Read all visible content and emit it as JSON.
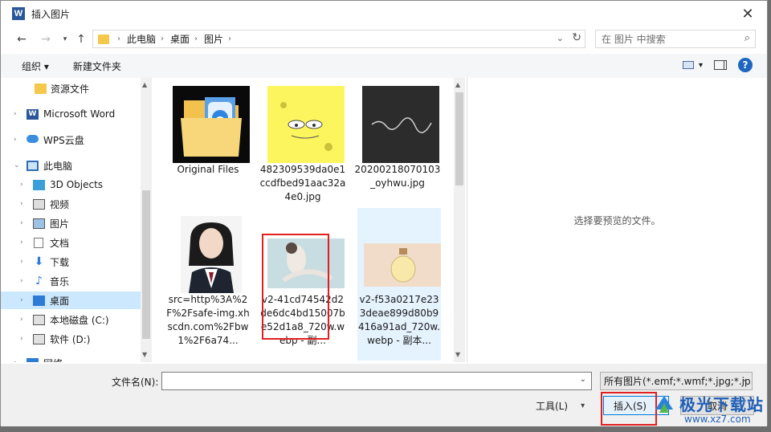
{
  "window": {
    "title": "插入图片",
    "app_icon": "W"
  },
  "nav": {
    "path": [
      "此电脑",
      "桌面",
      "图片"
    ],
    "search_placeholder": "在 图片 中搜索"
  },
  "toolbar": {
    "organize": "组织 ▾",
    "new_folder": "新建文件夹"
  },
  "sidebar": {
    "items": [
      {
        "label": "资源文件",
        "icon": "folder-icon"
      },
      {
        "label": "Microsoft Word",
        "icon": "word-icon"
      },
      {
        "label": "WPS云盘",
        "icon": "cloud-icon"
      },
      {
        "label": "此电脑",
        "icon": "computer-icon"
      },
      {
        "label": "3D Objects",
        "icon": "cube-icon"
      },
      {
        "label": "视频",
        "icon": "video-icon"
      },
      {
        "label": "图片",
        "icon": "picture-icon"
      },
      {
        "label": "文档",
        "icon": "document-icon"
      },
      {
        "label": "下载",
        "icon": "download-icon"
      },
      {
        "label": "音乐",
        "icon": "music-icon"
      },
      {
        "label": "桌面",
        "icon": "desktop-icon"
      },
      {
        "label": "本地磁盘 (C:)",
        "icon": "drive-icon"
      },
      {
        "label": "软件 (D:)",
        "icon": "drive-icon"
      },
      {
        "label": "网络",
        "icon": "network-icon"
      }
    ]
  },
  "files": [
    {
      "name": "Original Files",
      "kind": "folder"
    },
    {
      "name": "482309539da0e1ccdfbed91aac32a4e0.jpg",
      "kind": "image"
    },
    {
      "name": "20200218070103_oyhwu.jpg",
      "kind": "image"
    },
    {
      "name": "src=http%3A%2F%2Fsafe-img.xhscdn.com%2Fbw1%2F6a74...",
      "kind": "image"
    },
    {
      "name": "v2-41cd74542d2de6dc4bd15007be52d1a8_720w.webp - 副...",
      "kind": "image"
    },
    {
      "name": "v2-f53a0217e233deae899d80b9416a91ad_720w.webp - 副本...",
      "kind": "image"
    }
  ],
  "preview_text": "选择要预览的文件。",
  "footer": {
    "filename_label": "文件名(N):",
    "filename_value": "",
    "filter": "所有图片(*.emf;*.wmf;*.jpg;*.jp",
    "tools": "工具(L)",
    "insert": "插入(S)",
    "cancel": "取消"
  },
  "watermark": {
    "name": "极光下载站",
    "url": "www.xz7.com"
  },
  "colors": {
    "accent": "#0078d7",
    "highlight": "#e02020",
    "selection": "#cce8ff"
  }
}
